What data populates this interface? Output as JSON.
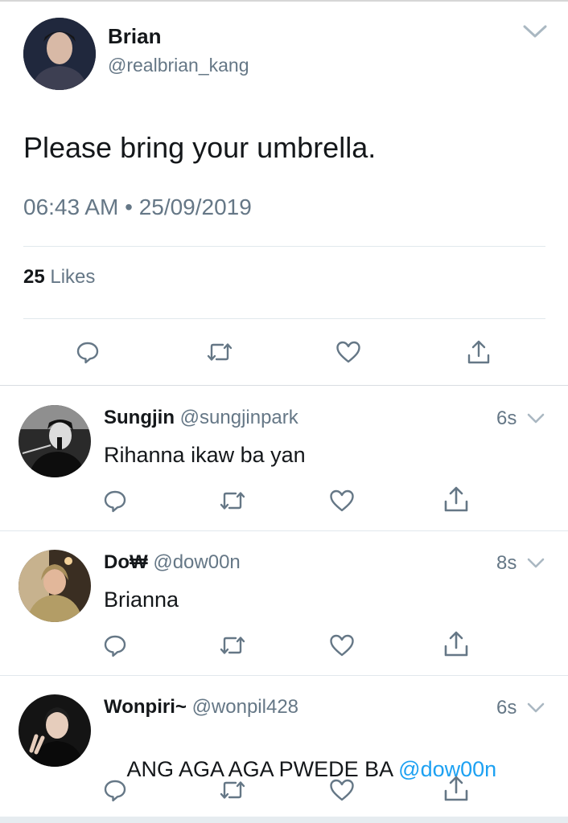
{
  "tweet": {
    "author_name": "Brian",
    "author_handle": "@realbrian_kang",
    "text": "Please bring your umbrella.",
    "time": "06:43 AM",
    "separator": "•",
    "date": "25/09/2019",
    "likes_count": "25",
    "likes_label": "Likes"
  },
  "replies": [
    {
      "name": "Sungjin",
      "handle": "@sungjinpark",
      "time": "6s",
      "text": "Rihanna ikaw ba yan",
      "mention": ""
    },
    {
      "name": "Do₩",
      "handle": "@dow00n",
      "time": "8s",
      "text": "Brianna",
      "mention": ""
    },
    {
      "name": "Wonpiri~",
      "handle": "@wonpil428",
      "time": "6s",
      "text": "ANG AGA AGA PWEDE BA ",
      "mention": "@dow00n"
    }
  ],
  "icons": [
    "reply-icon",
    "retweet-icon",
    "like-icon",
    "share-icon",
    "chevron-down-icon"
  ],
  "colors": {
    "text": "#14171a",
    "secondary": "#657786",
    "link": "#1da1f2",
    "divider": "#e1e8ed"
  }
}
